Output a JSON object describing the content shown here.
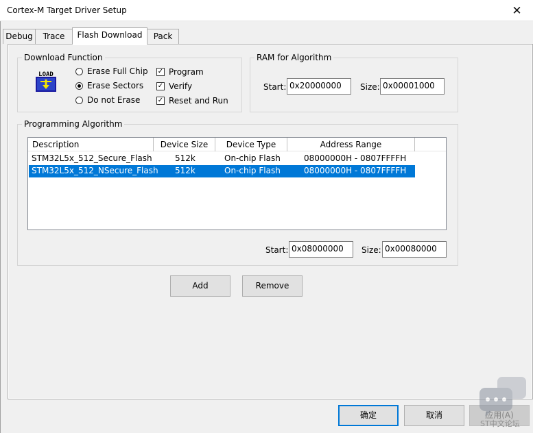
{
  "window": {
    "title": "Cortex-M Target Driver Setup",
    "close_glyph": "✕"
  },
  "tabs": [
    {
      "label": "Debug"
    },
    {
      "label": "Trace"
    },
    {
      "label": "Flash Download"
    },
    {
      "label": "Pack"
    }
  ],
  "download_function": {
    "label": "Download Function",
    "icon_text": "LOAD",
    "radios": [
      {
        "label": "Erase Full Chip",
        "checked": false
      },
      {
        "label": "Erase Sectors",
        "checked": true
      },
      {
        "label": "Do not Erase",
        "checked": false
      }
    ],
    "checks": [
      {
        "label": "Program",
        "checked": true
      },
      {
        "label": "Verify",
        "checked": true
      },
      {
        "label": "Reset and Run",
        "checked": true
      }
    ]
  },
  "ram": {
    "label": "RAM for Algorithm",
    "start_label": "Start:",
    "start_value": "0x20000000",
    "size_label": "Size:",
    "size_value": "0x00001000"
  },
  "programming": {
    "label": "Programming Algorithm",
    "columns": [
      "Description",
      "Device Size",
      "Device Type",
      "Address Range"
    ],
    "rows": [
      {
        "description": "STM32L5x_512_Secure_Flash",
        "size": "512k",
        "type": "On-chip Flash",
        "range": "08000000H - 0807FFFFH",
        "selected": false
      },
      {
        "description": "STM32L5x_512_NSecure_Flash",
        "size": "512k",
        "type": "On-chip Flash",
        "range": "08000000H - 0807FFFFH",
        "selected": true
      }
    ],
    "start_label": "Start:",
    "start_value": "0x08000000",
    "size_label": "Size:",
    "size_value": "0x00080000"
  },
  "buttons": {
    "add": "Add",
    "remove": "Remove",
    "ok": "确定",
    "cancel": "取消",
    "apply": "应用(A)"
  },
  "watermark": {
    "text": "ST中文论坛"
  },
  "colors": {
    "selection": "#0078d7",
    "default_border": "#0078d7",
    "panel": "#f0f0f0"
  }
}
